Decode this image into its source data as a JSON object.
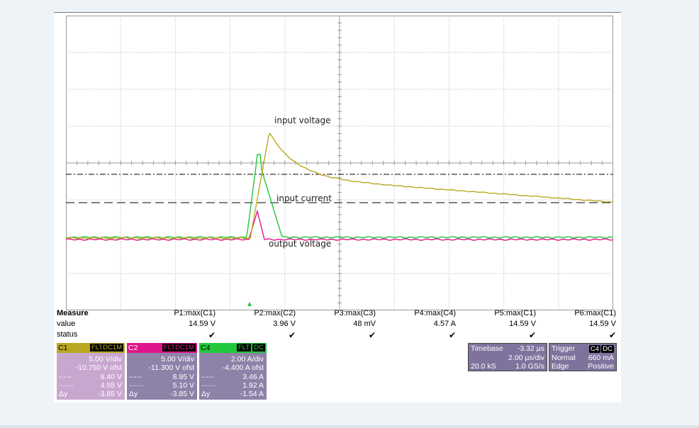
{
  "annotations": {
    "input_voltage": "input voltage",
    "input_current": "input current",
    "output_voltage": "output voltage"
  },
  "channel_markers": {
    "c1": "C1",
    "c2": "C2",
    "c4": "C4"
  },
  "colors": {
    "c1": "#b9a820",
    "c2": "#e0148a",
    "c4": "#22c83c",
    "grid": "#aaaaaa",
    "panel_c1": "#c8a7cf",
    "panel_c2": "#c8a7cf",
    "panel_c4": "#8f82a8",
    "timebase": "#7f739d"
  },
  "traces": {
    "input_voltage": {
      "baseline_v": 0,
      "peak_v": 14.59
    },
    "input_current": {
      "baseline_a": 0,
      "peak_a": 3.96
    },
    "output_voltage": {
      "baseline_v": 0,
      "peak_v": 4.57
    }
  },
  "measure": {
    "title": "Measure",
    "value_label": "value",
    "status_label": "status",
    "columns": [
      {
        "name": "P1:max(C1)",
        "value": "14.59 V"
      },
      {
        "name": "P2:max(C2)",
        "value": "3.96 V"
      },
      {
        "name": "P3:max(C3)",
        "value": "48 mV"
      },
      {
        "name": "P4:max(C4)",
        "value": "4.57 A"
      },
      {
        "name": "P5:max(C1)",
        "value": "14.59 V"
      },
      {
        "name": "P6:max(C1)",
        "value": "14.59 V"
      }
    ],
    "check": "✔"
  },
  "channels": [
    {
      "name": "C1",
      "tags": [
        "FLT",
        "DC1M"
      ],
      "vdiv": "5.00 V/div",
      "ofst": "-10.750 V ofst",
      "cur1_sym": "-·-·-",
      "cur1": "8.40 V",
      "cur2_sym": "······",
      "cur2": "4.55 V",
      "dy_label": "Δy",
      "dy": "-3.85 V"
    },
    {
      "name": "C2",
      "tags": [
        "FLT",
        "DC1M"
      ],
      "vdiv": "5.00 V/div",
      "ofst": "-11.300 V ofst",
      "cur1_sym": "-·-·-",
      "cur1": "8.95 V",
      "cur2_sym": "······",
      "cur2": "5.10 V",
      "dy_label": "Δy",
      "dy": "-3.85 V"
    },
    {
      "name": "C4",
      "tags": [
        "FLT",
        "DC"
      ],
      "vdiv": "2.00 A/div",
      "ofst": "-4.400 A ofst",
      "cur1_sym": "-·-·-",
      "cur1": "3.46 A",
      "cur2_sym": "······",
      "cur2": "1.92 A",
      "dy_label": "Δy",
      "dy": "-1.54 A"
    }
  ],
  "timebase": {
    "label": "Timebase",
    "delay": "-3.32 µs",
    "tdiv": "2.00 µs/div",
    "samples": "20.0 kS",
    "rate": "1.0 GS/s"
  },
  "trigger": {
    "label": "Trigger",
    "tags": [
      "C4",
      "DC"
    ],
    "mode": "Normal",
    "level": "660 mA",
    "type": "Edge",
    "slope": "Positive"
  }
}
